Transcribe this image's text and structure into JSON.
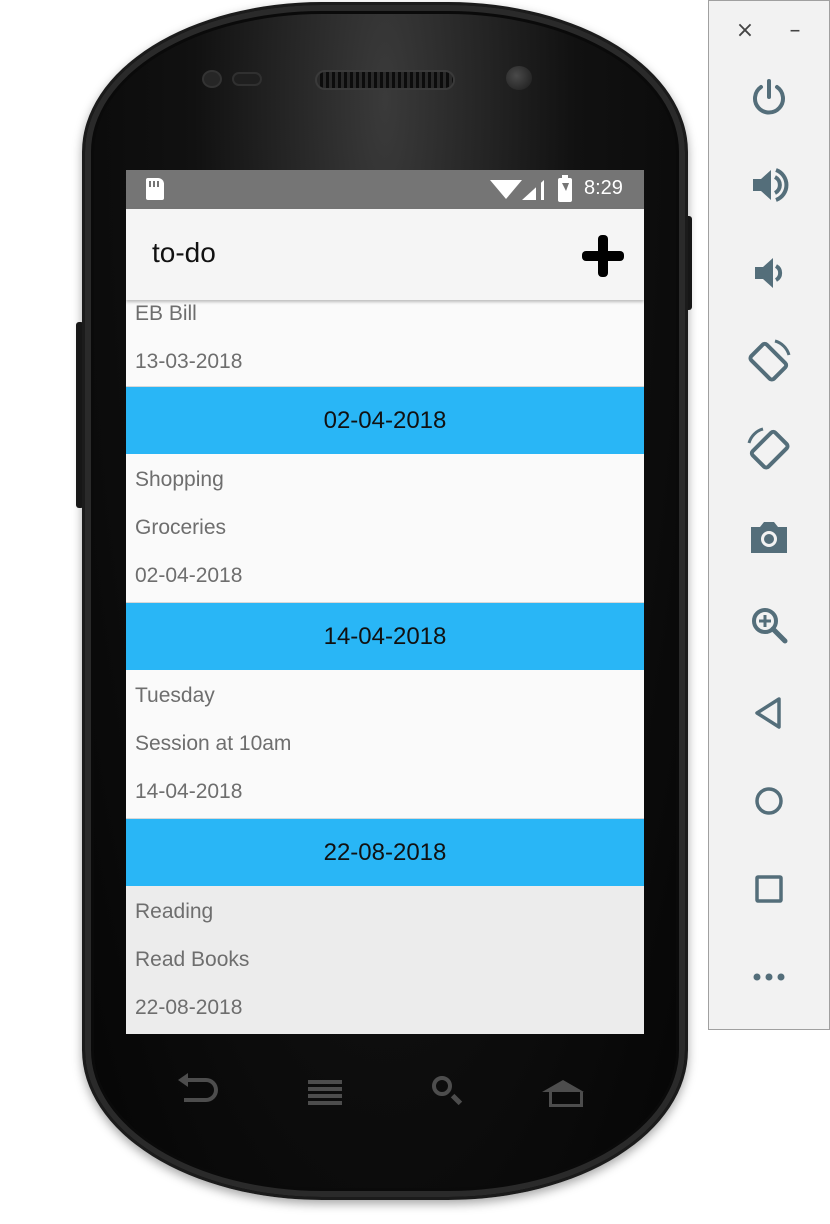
{
  "status_bar": {
    "time": "8:29"
  },
  "app_bar": {
    "title": "to-do"
  },
  "list": {
    "first_item": {
      "lines": [
        "EB Bill",
        "13-03-2018"
      ]
    },
    "sections": [
      {
        "header": "02-04-2018",
        "lines": [
          "Shopping",
          "Groceries",
          "02-04-2018"
        ],
        "pressed": false
      },
      {
        "header": "14-04-2018",
        "lines": [
          "Tuesday",
          "Session at 10am",
          "14-04-2018"
        ],
        "pressed": false
      },
      {
        "header": "22-08-2018",
        "lines": [
          "Reading",
          "Read Books",
          "22-08-2018"
        ],
        "pressed": true
      }
    ]
  },
  "emulator_toolbar": {
    "close_glyph": "×",
    "minimize_glyph": "–",
    "tools": [
      "power-icon",
      "volume-up-icon",
      "volume-down-icon",
      "rotate-left-icon",
      "rotate-right-icon",
      "camera-icon",
      "zoom-icon",
      "back-icon",
      "home-icon",
      "overview-icon",
      "more-icon"
    ]
  },
  "colors": {
    "status_bar": "#757575",
    "section_header": "#29b6f6",
    "toolbar_icon": "#546e7a"
  }
}
